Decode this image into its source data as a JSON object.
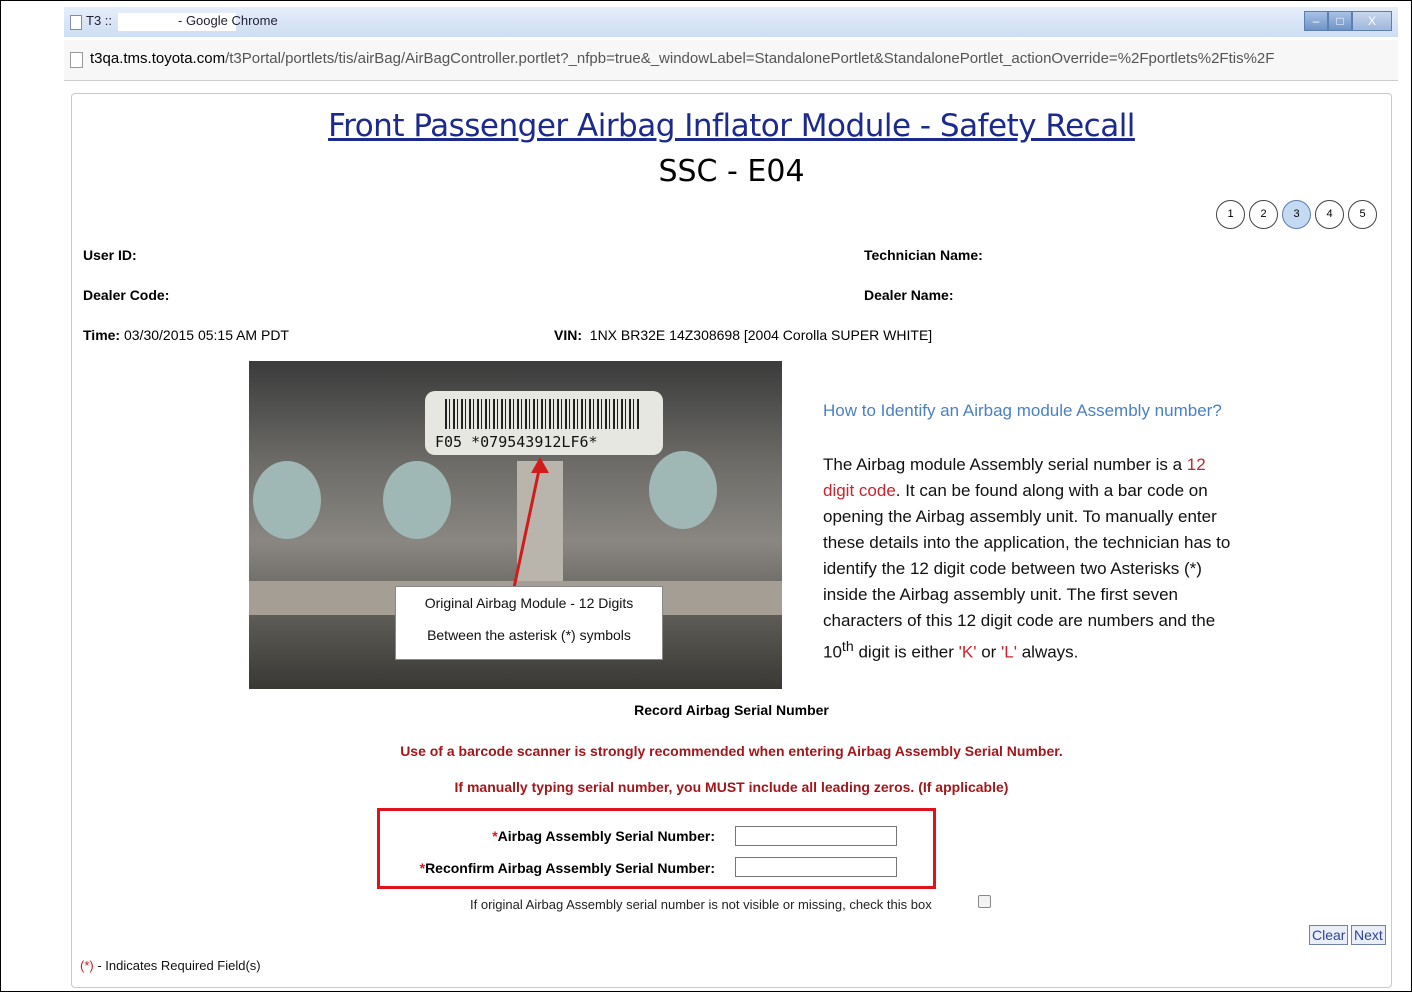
{
  "browser": {
    "tab_prefix": "T3 ::",
    "tab_title": "- Google Chrome",
    "url_host": "t3qa.tms.toyota.com",
    "url_path": "/t3Portal/portlets/tis/airBag/AirBagController.portlet?_nfpb=true&_windowLabel=StandalonePortlet&StandalonePortlet_actionOverride=%2Fportlets%2Ftis%2F",
    "controls": [
      "–",
      "□",
      "X"
    ]
  },
  "page": {
    "title": "Front Passenger Airbag Inflator Module - Safety Recall",
    "subtitle": "SSC - E04",
    "steps": [
      "1",
      "2",
      "3",
      "4",
      "5"
    ],
    "current_step": "3"
  },
  "info": {
    "user_id_label": "User ID:",
    "technician_label": "Technician Name:",
    "dealer_code_label": "Dealer Code:",
    "dealer_name_label": "Dealer Name:",
    "time_label": "Time:",
    "time_value": "03/30/2015 05:15 AM PDT",
    "vin_label": "VIN:",
    "vin_value": "1NX BR32E 14Z308698 [2004 Corolla SUPER WHITE]"
  },
  "image": {
    "barcode_text": "F05 *079543912LF6*",
    "callout_line1": "Original Airbag Module - 12 Digits",
    "callout_line2": "Between the asterisk (*) symbols"
  },
  "help": {
    "heading": "How to Identify an Airbag module Assembly number?",
    "p_part1": "The Airbag module Assembly serial number is a ",
    "p_red": "12 digit code",
    "p_part2": ". It can be found along with a bar code on opening the Airbag assembly unit. To manually enter these details into the application, the technician has to identify the 12 digit code between two Asterisks (*) inside the Airbag assembly unit. The first seven characters of this 12 digit code are numbers and the 10",
    "p_sup": "th",
    "p_part3": " digit is either ",
    "p_k": "'K'",
    "p_or": " or ",
    "p_l": "'L'",
    "p_end": " always."
  },
  "form": {
    "section_title": "Record Airbag Serial Number",
    "warning1": "Use of a barcode scanner is strongly recommended when entering Airbag Assembly Serial Number.",
    "warning2": "If manually typing serial number, you MUST include all leading zeros. (If applicable)",
    "required_star": "*",
    "serial_label": "Airbag Assembly Serial Number:",
    "serial_value": "",
    "reconfirm_label": "Reconfirm Airbag Assembly Serial Number:",
    "reconfirm_value": "",
    "missing_label": "If original Airbag Assembly serial number is not visible or missing, check this box",
    "clear_button": "Clear",
    "next_button": "Next",
    "required_note_star": "(*)",
    "required_note": " - Indicates Required Field(s)"
  }
}
